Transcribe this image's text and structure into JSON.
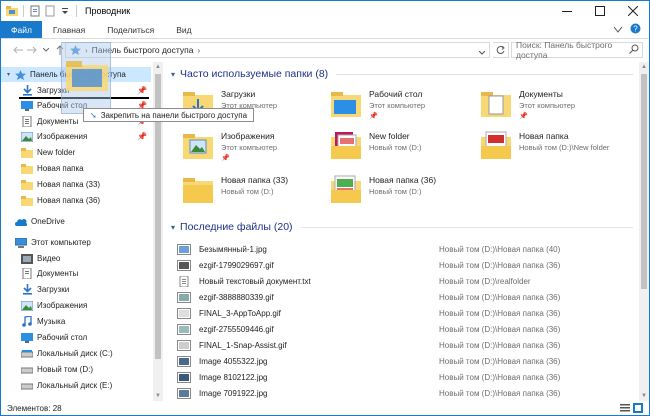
{
  "window": {
    "title": "Проводник"
  },
  "ribbon": {
    "tabs": [
      "Файл",
      "Главная",
      "Поделиться",
      "Вид"
    ]
  },
  "address": {
    "crumb": "Панель быстрого доступа",
    "search_placeholder": "Поиск: Панель быстрого доступа"
  },
  "nav": {
    "items": [
      {
        "label": "Панель быстрого доступа",
        "icon": "star-icon",
        "selected": true
      },
      {
        "label": "Загрузки",
        "icon": "download-icon",
        "pinned": true
      },
      {
        "label": "Рабочий стол",
        "icon": "desktop-icon",
        "pinned": true
      },
      {
        "label": "Документы",
        "icon": "documents-icon",
        "pinned": true
      },
      {
        "label": "Изображения",
        "icon": "pictures-icon",
        "pinned": true
      },
      {
        "label": "New folder",
        "icon": "folder-icon"
      },
      {
        "label": "Новая папка",
        "icon": "folder-icon"
      },
      {
        "label": "Новая папка (33)",
        "icon": "folder-icon"
      },
      {
        "label": "Новая папка (36)",
        "icon": "folder-icon"
      },
      {
        "label": "OneDrive",
        "icon": "onedrive-icon"
      },
      {
        "label": "Этот компьютер",
        "icon": "computer-icon"
      },
      {
        "label": "Видео",
        "icon": "video-icon"
      },
      {
        "label": "Документы",
        "icon": "documents-icon"
      },
      {
        "label": "Загрузки",
        "icon": "download-icon"
      },
      {
        "label": "Изображения",
        "icon": "pictures-icon"
      },
      {
        "label": "Музыка",
        "icon": "music-icon"
      },
      {
        "label": "Рабочий стол",
        "icon": "desktop-icon"
      },
      {
        "label": "Локальный диск (C:)",
        "icon": "drive-icon"
      },
      {
        "label": "Новый том (D:)",
        "icon": "drive-icon"
      },
      {
        "label": "Локальный диск (E:)",
        "icon": "drive-icon"
      }
    ]
  },
  "frequent": {
    "header": "Часто используемые папки (8)",
    "folders": [
      {
        "name": "Загрузки",
        "sub": "Этот компьютер",
        "pinned": true,
        "kind": "download"
      },
      {
        "name": "Рабочий стол",
        "sub": "Этот компьютер",
        "pinned": true,
        "kind": "desktop"
      },
      {
        "name": "Документы",
        "sub": "Этот компьютер",
        "pinned": true,
        "kind": "documents"
      },
      {
        "name": "Изображения",
        "sub": "Этот компьютер",
        "pinned": true,
        "kind": "pictures"
      },
      {
        "name": "New folder",
        "sub": "Новый том (D:)",
        "pinned": false,
        "kind": "content"
      },
      {
        "name": "Новая папка",
        "sub": "Новый том (D:)\\New folder",
        "pinned": false,
        "kind": "content"
      },
      {
        "name": "Новая папка (33)",
        "sub": "Новый том (D:)",
        "pinned": false,
        "kind": "plain"
      },
      {
        "name": "Новая папка (36)",
        "sub": "Новый том (D:)",
        "pinned": false,
        "kind": "content"
      }
    ]
  },
  "recent": {
    "header": "Последние файлы (20)",
    "files": [
      {
        "name": "Безымянный-1.jpg",
        "path": "Новый том (D:)\\Новая папка (40)",
        "kind": "image"
      },
      {
        "name": "ezgif-1799029697.gif",
        "path": "Новый том (D:)\\Новая папка (36)",
        "kind": "image"
      },
      {
        "name": "Новый текстовый документ.txt",
        "path": "Новый том (D:)\\realfolder",
        "kind": "text"
      },
      {
        "name": "ezgif-3888880339.gif",
        "path": "Новый том (D:)\\Новая папка (36)",
        "kind": "image"
      },
      {
        "name": "FINAL_3-AppToApp.gif",
        "path": "Новый том (D:)\\Новая папка (36)",
        "kind": "image"
      },
      {
        "name": "ezgif-2755509446.gif",
        "path": "Новый том (D:)\\Новая папка (36)",
        "kind": "image"
      },
      {
        "name": "FINAL_1-Snap-Assist.gif",
        "path": "Новый том (D:)\\Новая папка (36)",
        "kind": "image"
      },
      {
        "name": "Image 4055322.jpg",
        "path": "Новый том (D:)\\Новая папка (36)",
        "kind": "image"
      },
      {
        "name": "Image 8102122.jpg",
        "path": "Новый том (D:)\\Новая папка (36)",
        "kind": "image"
      },
      {
        "name": "Image 7091922.jpg",
        "path": "Новый том (D:)\\Новая папка (36)",
        "kind": "image"
      }
    ]
  },
  "drag": {
    "tooltip": "Закрепить на панели быстрого доступа"
  },
  "status": {
    "items_count": "Элементов: 28"
  },
  "colors": {
    "accent": "#1979ca",
    "selection": "#cce8ff",
    "folder": "#f8d775",
    "header_text": "#1e3287"
  }
}
